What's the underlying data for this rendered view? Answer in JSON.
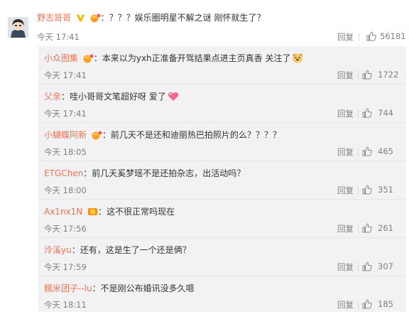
{
  "main_comment": {
    "username": "野志哥哥",
    "text": "：？？？娱乐圈明星不解之谜 刚怀就生了？",
    "time": "今天 17:41",
    "reply_label": "回复",
    "likes": "56181",
    "colors": {
      "username": "#eb7350",
      "vip": "#f7b500",
      "text": "#333333",
      "meta": "#808080"
    }
  },
  "sub_comments": [
    {
      "username": "小众图集",
      "text": "：本来以为yxh正准备开驾结果点进主页真香 关注了",
      "time": "今天 17:41",
      "reply_label": "回复",
      "likes": "1722",
      "badge": "crown-badge-icon",
      "emoji": "dog-emoji-icon"
    },
    {
      "username": "父亲",
      "text": "：哇小哥哥文笔超好呀 爱了",
      "time": "今天 17:41",
      "reply_label": "回复",
      "likes": "744",
      "badge": "",
      "emoji": "heart-emoji-icon"
    },
    {
      "username": "小蝴蝶阿新",
      "text": "：前几天不是还和迪丽热巴拍照片的么？？？？",
      "time": "今天 18:05",
      "reply_label": "回复",
      "likes": "465",
      "badge": "crown-badge-icon",
      "emoji": ""
    },
    {
      "username": "ETGChen",
      "text": "：前几天奚梦瑶不是还拍杂志，出活动吗？",
      "time": "今天 18:00",
      "reply_label": "回复",
      "likes": "351",
      "badge": "",
      "emoji": ""
    },
    {
      "username": "Ax1nx1N",
      "text": "：这不很正常吗现在",
      "time": "今天 17:56",
      "reply_label": "回复",
      "likes": "261",
      "badge": "fan-badge-icon",
      "emoji": ""
    },
    {
      "username": "泠溪yu",
      "text": "：还有，这是生了一个还是俩？",
      "time": "今天 17:59",
      "reply_label": "回复",
      "likes": "307",
      "badge": "",
      "emoji": ""
    },
    {
      "username": "糯米团子--lu",
      "text": "：不是刚公布婚讯没多久嗯",
      "time": "今天 18:11",
      "reply_label": "回复",
      "likes": "185",
      "badge": "",
      "emoji": ""
    }
  ]
}
